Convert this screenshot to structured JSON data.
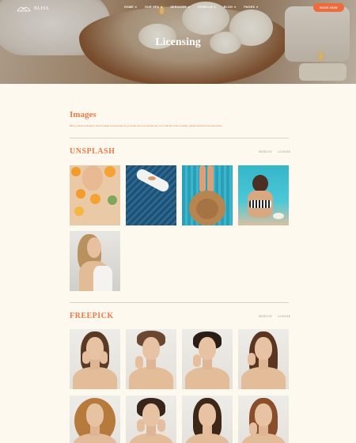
{
  "brand": {
    "name": "BLISS"
  },
  "nav": {
    "items": [
      {
        "label": "HOME"
      },
      {
        "label": "OUR SPA"
      },
      {
        "label": "SERVICES"
      },
      {
        "label": "UPSELLS"
      },
      {
        "label": "BLOG"
      },
      {
        "label": "PAGES"
      }
    ],
    "cta_label": "BOOK NOW"
  },
  "hero": {
    "title": "Licensing"
  },
  "images_section": {
    "heading": "Images",
    "intro": "Bliss product included in this template are licensed for personal and commercial use. For a full list of the credit(s), please check the license below."
  },
  "sources": [
    {
      "title": "UNSPLASH",
      "links": [
        "WEBSITE",
        "LICENSE"
      ],
      "images": [
        {
          "name": "unsplash-image-oranges"
        },
        {
          "name": "unsplash-image-boat"
        },
        {
          "name": "unsplash-image-pool-hat"
        },
        {
          "name": "unsplash-image-pool-swimsuit"
        },
        {
          "name": "unsplash-image-woman-back"
        }
      ]
    },
    {
      "title": "FREEPICK",
      "links": [
        "WEBSITE",
        "LICENSE"
      ],
      "images": [
        {
          "name": "freepick-image-1"
        },
        {
          "name": "freepick-image-2"
        },
        {
          "name": "freepick-image-3"
        },
        {
          "name": "freepick-image-4"
        },
        {
          "name": "freepick-image-5"
        },
        {
          "name": "freepick-image-6"
        },
        {
          "name": "freepick-image-7"
        },
        {
          "name": "freepick-image-8"
        }
      ]
    }
  ],
  "colors": {
    "accent": "#ee7b4a",
    "button": "#f06a3a",
    "page_bg": "#fdf9ee"
  }
}
